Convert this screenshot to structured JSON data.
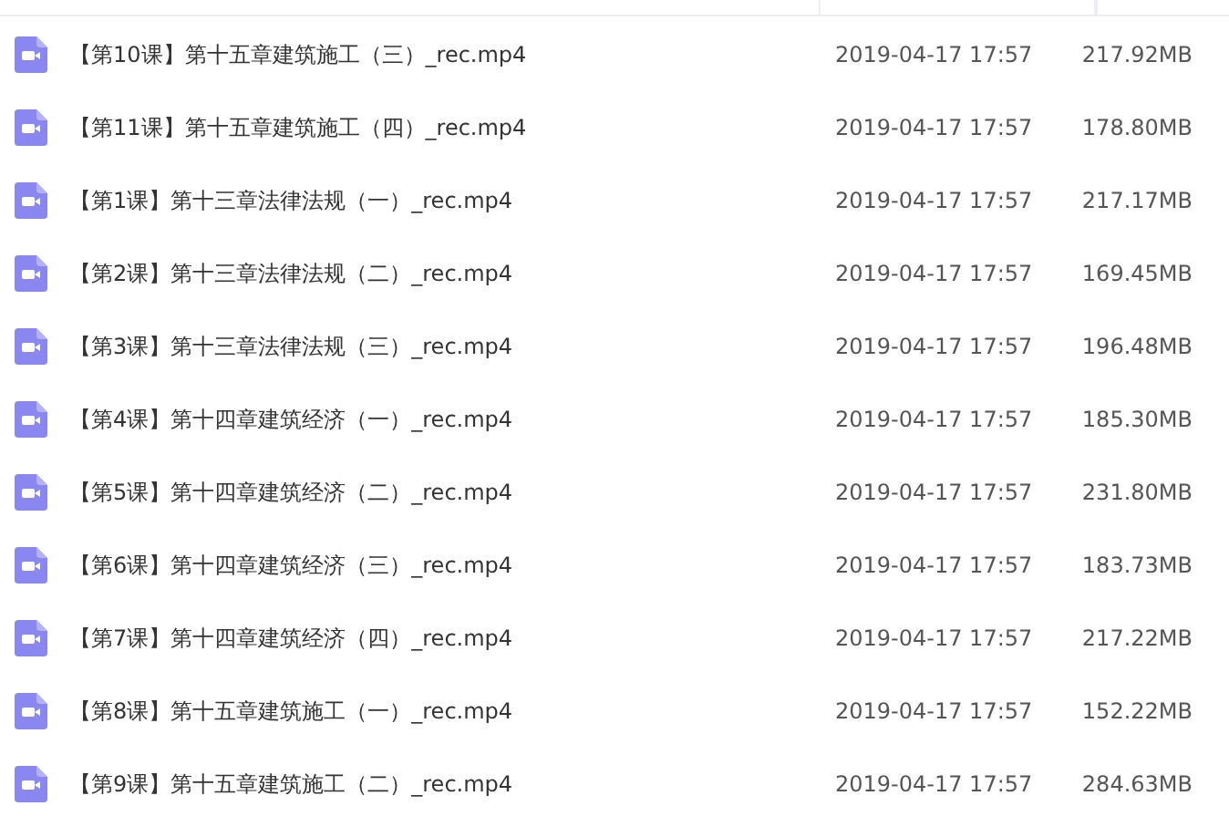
{
  "files": [
    {
      "name": "【第10课】第十五章建筑施工（三）_rec.mp4",
      "date": "2019-04-17 17:57",
      "size": "217.92MB"
    },
    {
      "name": "【第11课】第十五章建筑施工（四）_rec.mp4",
      "date": "2019-04-17 17:57",
      "size": "178.80MB"
    },
    {
      "name": "【第1课】第十三章法律法规（一）_rec.mp4",
      "date": "2019-04-17 17:57",
      "size": "217.17MB"
    },
    {
      "name": "【第2课】第十三章法律法规（二）_rec.mp4",
      "date": "2019-04-17 17:57",
      "size": "169.45MB"
    },
    {
      "name": "【第3课】第十三章法律法规（三）_rec.mp4",
      "date": "2019-04-17 17:57",
      "size": "196.48MB"
    },
    {
      "name": "【第4课】第十四章建筑经济（一）_rec.mp4",
      "date": "2019-04-17 17:57",
      "size": "185.30MB"
    },
    {
      "name": "【第5课】第十四章建筑经济（二）_rec.mp4",
      "date": "2019-04-17 17:57",
      "size": "231.80MB"
    },
    {
      "name": "【第6课】第十四章建筑经济（三）_rec.mp4",
      "date": "2019-04-17 17:57",
      "size": "183.73MB"
    },
    {
      "name": "【第7课】第十四章建筑经济（四）_rec.mp4",
      "date": "2019-04-17 17:57",
      "size": "217.22MB"
    },
    {
      "name": "【第8课】第十五章建筑施工（一）_rec.mp4",
      "date": "2019-04-17 17:57",
      "size": "152.22MB"
    },
    {
      "name": "【第9课】第十五章建筑施工（二）_rec.mp4",
      "date": "2019-04-17 17:57",
      "size": "284.63MB"
    }
  ]
}
